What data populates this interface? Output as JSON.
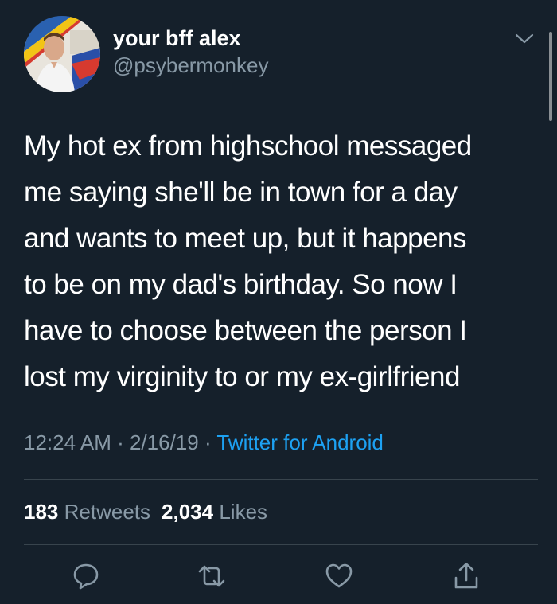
{
  "user": {
    "display_name": "your bff alex",
    "handle": "@psybermonkey"
  },
  "tweet": {
    "lines": [
      "My hot ex from highschool messaged",
      "me saying she'll be in town for a day",
      "and wants to meet up, but it happens",
      "to be on my dad's birthday. So now I",
      "have to choose between the person I",
      "lost my virginity to or my ex-girlfriend"
    ]
  },
  "meta": {
    "time": "12:24 AM",
    "sep1": " · ",
    "date": "2/16/19",
    "sep2": " · ",
    "source": "Twitter for Android"
  },
  "stats": {
    "retweets_count": "183",
    "retweets_label": "Retweets",
    "likes_count": "2,034",
    "likes_label": "Likes"
  },
  "icons": {
    "reply": "speech-bubble-icon",
    "retweet": "retweet-icon",
    "like": "heart-icon",
    "share": "share-icon",
    "menu": "chevron-down-icon"
  },
  "colors": {
    "background": "#15202b",
    "text": "#ffffff",
    "secondary": "#8899a6",
    "link": "#1da1f2",
    "divider": "#38444d"
  }
}
